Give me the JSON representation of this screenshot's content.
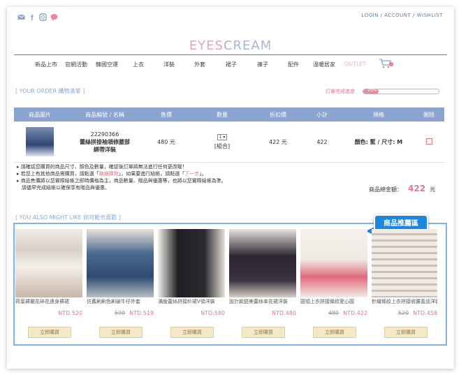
{
  "header": {
    "links": "LOGIN / ACCOUNT / WISHLIST",
    "logo_a": "EYES",
    "logo_b": "CREAM"
  },
  "social": [
    "mail-icon",
    "facebook-icon",
    "instagram-icon",
    "chat-icon"
  ],
  "nav": {
    "items": [
      "新品上市",
      "官網活動",
      "韓國空運",
      "上衣",
      "洋裝",
      "外套",
      "裙子",
      "褲子",
      "配件",
      "溫暖居家",
      "OUTLET"
    ],
    "cart_badge": "0"
  },
  "order": {
    "title": "[ YOUR ORDER 購物清單 ]",
    "progress_label": "訂單完成進度",
    "progress_pct": "20%",
    "progress_value": 0.2
  },
  "table": {
    "headers": [
      "商品圖片",
      "商品編號 / 名稱",
      "售價",
      "數量",
      "折扣價",
      "小計",
      "規格",
      "刪除"
    ],
    "row": {
      "code": "22290366",
      "name1": "蕾絲拼接袖領修腰部",
      "name2": "綁帶洋裝",
      "price": "480 元",
      "qty": "1",
      "qty_note": "[組合]",
      "discount": "422 元",
      "subtotal": "422",
      "spec": "顏色: 藍 / 尺寸: M"
    }
  },
  "notes": {
    "line1": "▸ 請確認您購買的商品尺寸、顏色及數量，確認後訂單將無法進行任何更改喔！",
    "line2a": "▸ 若您上有其他商品需購買，請點選「",
    "line2b": "繼續購物",
    "line2c": "」，如果要進行結帳，請點選「",
    "line2d": "下一步",
    "line2e": "」。",
    "line3": "▸ 商品售價將以您實際結帳之即時價格為主，商品數量、贈品與優惠等，也將以您實際結帳為準。",
    "line4": "　請儘早完成結帳以確保享有贈品與優惠。"
  },
  "total": {
    "label": "商品總金額：",
    "amount": "422",
    "unit": "元"
  },
  "recommend": {
    "title": "[ YOU ALSO MIGHT LIKE 妳可能也喜歡 ]",
    "callout": "商品推薦區",
    "buy_label": "立即購買",
    "products": [
      {
        "name": "荷葉褲擺花碎花連身褲裙",
        "old": "",
        "price": "NTD.520"
      },
      {
        "name": "仿舊刷刷色刷破牛仔外套",
        "old": "590",
        "price": "NTD.519"
      },
      {
        "name": "滿版蕾絲拼接紗裙V領洋裝",
        "old": "",
        "price": "NTD.580"
      },
      {
        "name": "設計款甜美蕾絲傘花裙洋裝",
        "old": "",
        "price": "NTD.480"
      },
      {
        "name": "圓領上衣拼接條紋愛心圓",
        "old": "480",
        "price": "NTD.422"
      },
      {
        "name": "針織條紋上衣拼接收腰喜話洋裝",
        "old": "520",
        "price": "NTD.458"
      }
    ]
  }
}
